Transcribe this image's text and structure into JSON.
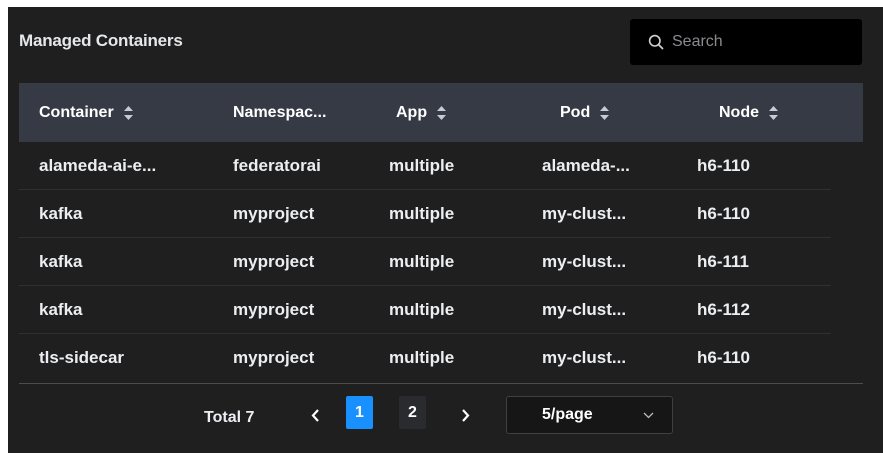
{
  "panel": {
    "title": "Managed Containers"
  },
  "search": {
    "placeholder": "Search",
    "icon": "search-icon"
  },
  "table": {
    "columns": [
      {
        "label": "Container",
        "sortable": true
      },
      {
        "label": "Namespac...",
        "sortable": false
      },
      {
        "label": "App",
        "sortable": true
      },
      {
        "label": "Pod",
        "sortable": true
      },
      {
        "label": "Node",
        "sortable": true
      }
    ],
    "rows": [
      [
        "alameda-ai-e...",
        "federatorai",
        "multiple",
        "alameda-...",
        "h6-110"
      ],
      [
        "kafka",
        "myproject",
        "multiple",
        "my-clust...",
        "h6-110"
      ],
      [
        "kafka",
        "myproject",
        "multiple",
        "my-clust...",
        "h6-111"
      ],
      [
        "kafka",
        "myproject",
        "multiple",
        "my-clust...",
        "h6-112"
      ],
      [
        "tls-sidecar",
        "myproject",
        "multiple",
        "my-clust...",
        "h6-110"
      ]
    ]
  },
  "pagination": {
    "total_label": "Total 7",
    "pages": [
      "1",
      "2"
    ],
    "current_page": 1,
    "page_size": "5/page"
  },
  "colors": {
    "background": "#1f1f20",
    "header": "#363a45",
    "accent": "#1890ff",
    "text": "#eceef1"
  }
}
